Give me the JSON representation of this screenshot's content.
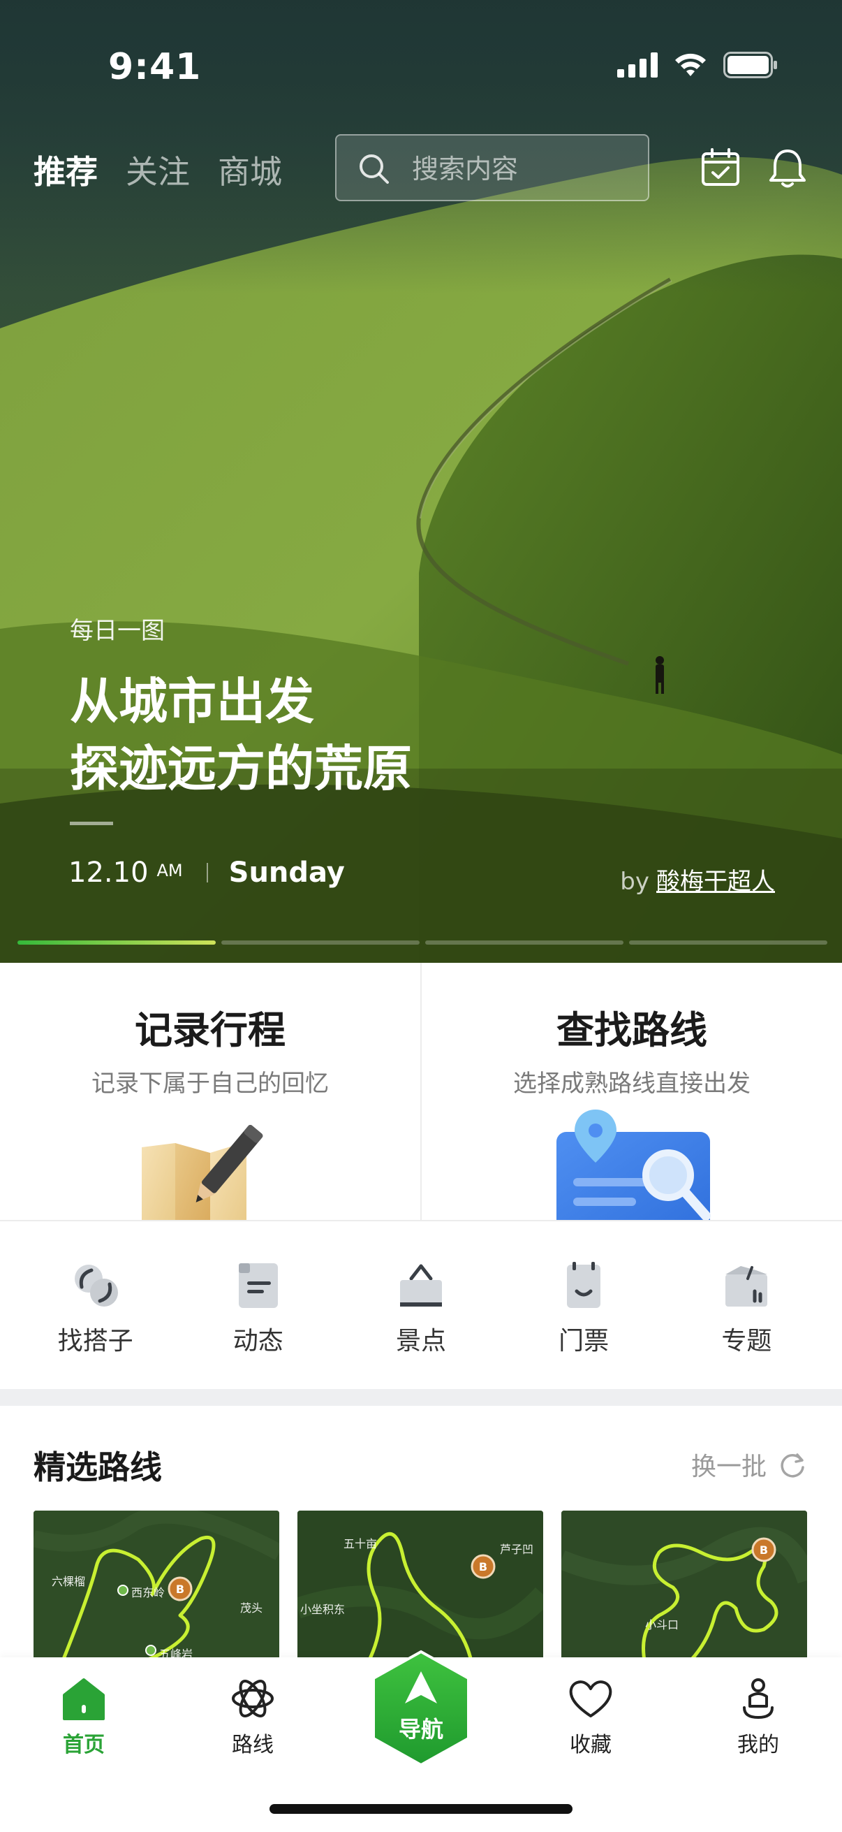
{
  "status_bar": {
    "time": "9:41"
  },
  "top_nav": {
    "tabs": [
      {
        "label": "推荐",
        "active": true
      },
      {
        "label": "关注",
        "active": false
      },
      {
        "label": "商城",
        "active": false
      }
    ],
    "search_placeholder": "搜索内容",
    "icons": [
      "calendar-check-icon",
      "bell-icon"
    ]
  },
  "hero": {
    "tag": "每日一图",
    "title_line1": "从城市出发",
    "title_line2": "探迹远方的荒原",
    "date": "12.10",
    "ampm": "AM",
    "weekday": "Sunday",
    "by_prefix": "by",
    "author": "酸梅干超人",
    "carousel_pages": 4,
    "carousel_active_index": 0
  },
  "cards": [
    {
      "title": "记录行程",
      "subtitle": "记录下属于自己的回忆",
      "icon": "map-pencil-icon"
    },
    {
      "title": "查找路线",
      "subtitle": "选择成熟路线直接出发",
      "icon": "map-search-icon"
    }
  ],
  "quick_links": [
    {
      "label": "找搭子",
      "icon": "partner-icon"
    },
    {
      "label": "动态",
      "icon": "feed-icon"
    },
    {
      "label": "景点",
      "icon": "scenic-icon"
    },
    {
      "label": "门票",
      "icon": "ticket-icon"
    },
    {
      "label": "专题",
      "icon": "topic-icon"
    }
  ],
  "routes": {
    "title": "精选路线",
    "refresh_label": "换一批",
    "cards": [
      {
        "labels": [
          "六棵榴",
          "西东岭",
          "五峰岩",
          "茂头"
        ]
      },
      {
        "labels": [
          "五十亩",
          "芦子凹",
          "小坐积东"
        ]
      },
      {
        "labels": [
          "小斗口"
        ]
      }
    ]
  },
  "tabbar": {
    "items": [
      {
        "label": "首页",
        "icon": "home-icon",
        "active": true
      },
      {
        "label": "路线",
        "icon": "route-icon",
        "active": false
      },
      {
        "label": "导航",
        "icon": "navigation-icon",
        "active": false
      },
      {
        "label": "收藏",
        "icon": "heart-icon",
        "active": false
      },
      {
        "label": "我的",
        "icon": "profile-icon",
        "active": false
      }
    ]
  },
  "colors": {
    "accent_green": "#2aa336",
    "hero_progress_start": "#35b93a",
    "hero_progress_end": "#cfe25a",
    "route_line": "#c8f032",
    "badge_orange": "#c9782a"
  }
}
